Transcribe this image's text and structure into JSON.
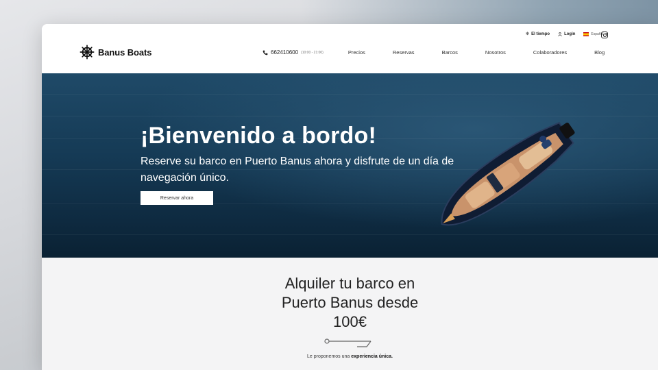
{
  "header": {
    "brand": "Banus Boats",
    "topbar": {
      "weather": "El tiempo",
      "login": "Login",
      "language": "Español"
    },
    "phone": {
      "number": "662410600",
      "hours": "(10:00 - 21:00)"
    },
    "nav": [
      "Precios",
      "Reservas",
      "Barcos",
      "Nosotros",
      "Colaboradores",
      "Blog"
    ]
  },
  "hero": {
    "title": "¡Bienvenido a bordo!",
    "subtitle": "Reserve su barco en Puerto Banus ahora y disfrute de un día de navegación único.",
    "button": "Reservar ahora"
  },
  "intro": {
    "title_line1": "Alquiler tu barco en",
    "title_line2": "Puerto Banus desde",
    "title_line3": "100€",
    "text_prefix": "Le proponemos una",
    "text_bold": "experiencia única."
  },
  "colors": {
    "sea_dark": "#0e2a40",
    "sea_light": "#2a5675",
    "lower_bg": "#f4f4f5"
  },
  "icons": [
    "ship-wheel-icon",
    "phone-icon",
    "weather-icon",
    "user-icon",
    "spain-flag-icon",
    "instagram-icon",
    "rope-divider-icon"
  ]
}
